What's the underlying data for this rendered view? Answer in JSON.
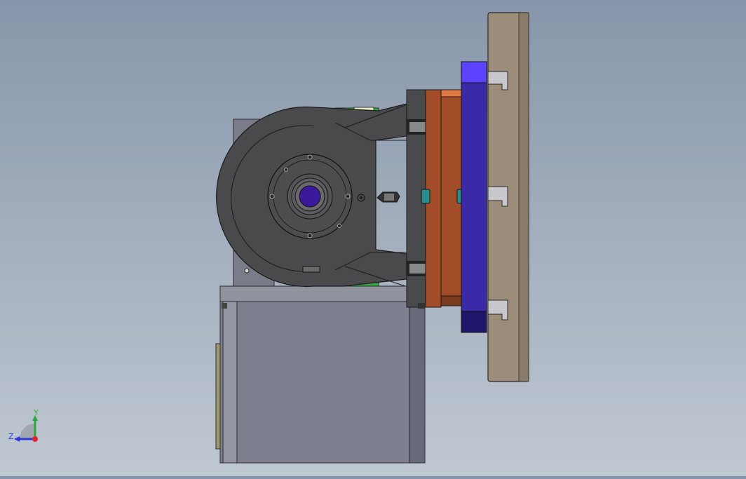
{
  "viewport": {
    "background_top": "#8796aa",
    "background_bottom": "#c0c8d2"
  },
  "model": {
    "colors": {
      "housing_dark": "#4a4a4d",
      "gearbox_gray": "#7e8090",
      "copper_plate": "#a24d28",
      "orange_plate": "#e07a42",
      "blue_plate": "#3a2aa8",
      "blue_plate_light": "#5b43ff",
      "tan_mount": "#9c8c7a",
      "green_part": "#3ca34a",
      "teal_pin": "#2a8c8c",
      "bore_purple": "#3a1a9a"
    }
  },
  "triad": {
    "y_label": "Y",
    "z_label": "Z",
    "icon": "axis-triad-icon",
    "x_color": "#e0242c",
    "y_color": "#2aa83a",
    "z_color": "#2a3ad8"
  }
}
